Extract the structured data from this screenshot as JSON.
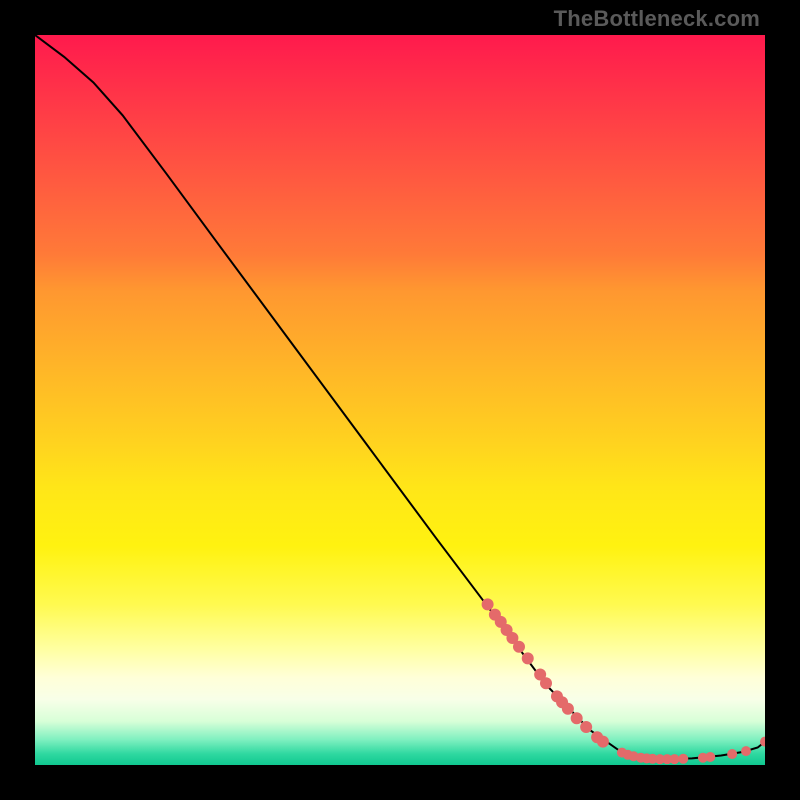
{
  "watermark": "TheBottleneck.com",
  "colors": {
    "marker": "#e46a6a",
    "curve": "#000000"
  },
  "chart_data": {
    "type": "line",
    "title": "",
    "xlabel": "",
    "ylabel": "",
    "xlim": [
      0,
      100
    ],
    "ylim": [
      0,
      100
    ],
    "grid": false,
    "curve_points": [
      {
        "x": 0.0,
        "y": 100.0
      },
      {
        "x": 4.0,
        "y": 97.0
      },
      {
        "x": 8.0,
        "y": 93.5
      },
      {
        "x": 12.0,
        "y": 89.0
      },
      {
        "x": 18.0,
        "y": 81.0
      },
      {
        "x": 25.0,
        "y": 71.5
      },
      {
        "x": 35.0,
        "y": 58.0
      },
      {
        "x": 45.0,
        "y": 44.5
      },
      {
        "x": 55.0,
        "y": 31.0
      },
      {
        "x": 63.0,
        "y": 20.4
      },
      {
        "x": 70.0,
        "y": 11.0
      },
      {
        "x": 76.0,
        "y": 4.8
      },
      {
        "x": 80.0,
        "y": 2.0
      },
      {
        "x": 83.0,
        "y": 1.0
      },
      {
        "x": 86.0,
        "y": 0.8
      },
      {
        "x": 90.0,
        "y": 0.9
      },
      {
        "x": 94.0,
        "y": 1.3
      },
      {
        "x": 97.0,
        "y": 1.8
      },
      {
        "x": 99.0,
        "y": 2.4
      },
      {
        "x": 100.0,
        "y": 3.2
      }
    ],
    "markers": [
      {
        "x": 62.0,
        "y": 22.0,
        "r": 6
      },
      {
        "x": 63.0,
        "y": 20.6,
        "r": 6
      },
      {
        "x": 63.8,
        "y": 19.6,
        "r": 6
      },
      {
        "x": 64.6,
        "y": 18.5,
        "r": 6
      },
      {
        "x": 65.4,
        "y": 17.4,
        "r": 6
      },
      {
        "x": 66.3,
        "y": 16.2,
        "r": 6
      },
      {
        "x": 67.5,
        "y": 14.6,
        "r": 6
      },
      {
        "x": 69.2,
        "y": 12.4,
        "r": 6
      },
      {
        "x": 70.0,
        "y": 11.2,
        "r": 6
      },
      {
        "x": 71.5,
        "y": 9.4,
        "r": 6
      },
      {
        "x": 72.2,
        "y": 8.6,
        "r": 6
      },
      {
        "x": 73.0,
        "y": 7.7,
        "r": 6
      },
      {
        "x": 74.2,
        "y": 6.4,
        "r": 6
      },
      {
        "x": 75.5,
        "y": 5.2,
        "r": 6
      },
      {
        "x": 77.0,
        "y": 3.8,
        "r": 6
      },
      {
        "x": 77.8,
        "y": 3.2,
        "r": 6
      },
      {
        "x": 80.4,
        "y": 1.7,
        "r": 5
      },
      {
        "x": 81.2,
        "y": 1.4,
        "r": 5
      },
      {
        "x": 82.0,
        "y": 1.2,
        "r": 5
      },
      {
        "x": 83.0,
        "y": 1.0,
        "r": 5
      },
      {
        "x": 83.8,
        "y": 0.9,
        "r": 5
      },
      {
        "x": 84.6,
        "y": 0.85,
        "r": 5
      },
      {
        "x": 85.6,
        "y": 0.8,
        "r": 5
      },
      {
        "x": 86.6,
        "y": 0.8,
        "r": 5
      },
      {
        "x": 87.6,
        "y": 0.8,
        "r": 5
      },
      {
        "x": 88.8,
        "y": 0.85,
        "r": 5
      },
      {
        "x": 91.5,
        "y": 1.0,
        "r": 5
      },
      {
        "x": 92.5,
        "y": 1.1,
        "r": 5
      },
      {
        "x": 95.5,
        "y": 1.5,
        "r": 5
      },
      {
        "x": 97.4,
        "y": 1.9,
        "r": 5
      },
      {
        "x": 100.0,
        "y": 3.2,
        "r": 5
      }
    ]
  }
}
